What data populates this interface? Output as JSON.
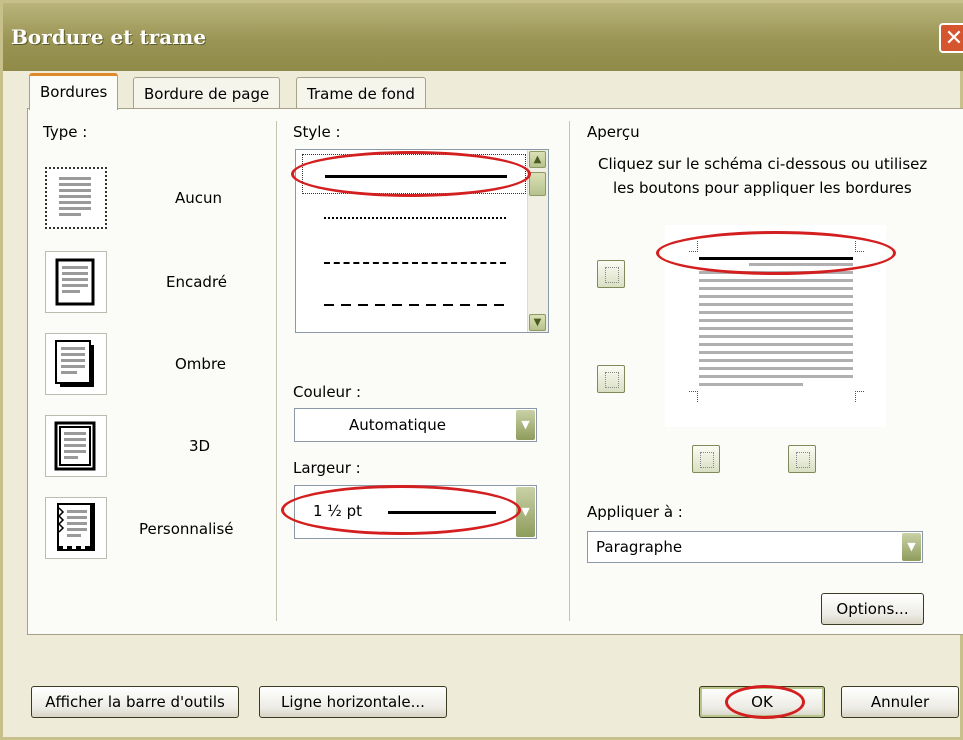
{
  "window": {
    "title": "Bordure et trame"
  },
  "tabs": [
    {
      "label": "Bordures"
    },
    {
      "label": "Bordure de page"
    },
    {
      "label": "Trame de fond"
    }
  ],
  "type_section": {
    "label": "Type :",
    "items": [
      {
        "label": "Aucun"
      },
      {
        "label": "Encadré"
      },
      {
        "label": "Ombre"
      },
      {
        "label": "3D"
      },
      {
        "label": "Personnalisé"
      }
    ]
  },
  "style_section": {
    "label": "Style :",
    "color_label": "Couleur :",
    "color_value": "Automatique",
    "width_label": "Largeur :",
    "width_value": "1 ½ pt"
  },
  "preview": {
    "label": "Aperçu",
    "instruction_line1": "Cliquez sur le schéma ci-dessous ou utilisez",
    "instruction_line2": "les boutons pour appliquer les bordures",
    "apply_label": "Appliquer à :",
    "apply_value": "Paragraphe",
    "options_label": "Options..."
  },
  "footer": {
    "toolbar_button": "Afficher la barre d'outils",
    "hline_button": "Ligne horizontale...",
    "ok_button": "OK",
    "cancel_button": "Annuler"
  },
  "colors": {
    "titlebar": "#9a9554",
    "highlight_ring": "#d31f1f",
    "tab_accent": "#e08a2c"
  }
}
